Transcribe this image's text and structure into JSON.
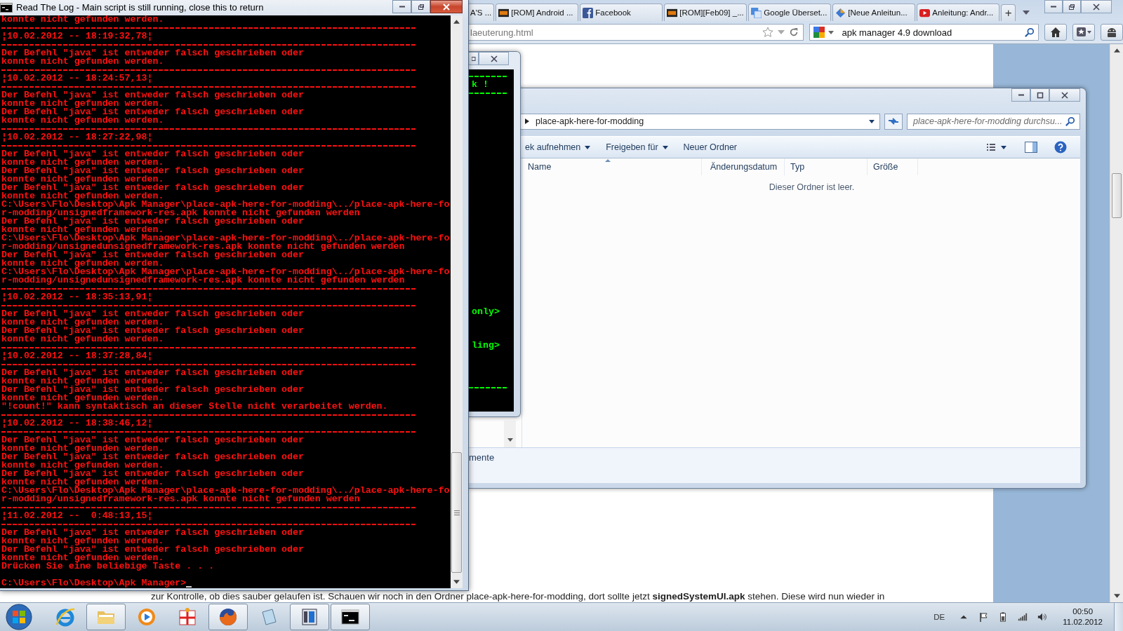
{
  "browser": {
    "tabs": [
      {
        "label": "A'S ...",
        "kind": "none"
      },
      {
        "label": "[ROM] Android ...",
        "kind": "xda"
      },
      {
        "label": "Facebook",
        "kind": "facebook"
      },
      {
        "label": "[ROM][Feb09] _...",
        "kind": "xda"
      },
      {
        "label": "Google Überset...",
        "kind": "translate"
      },
      {
        "label": "[Neue Anleitun...",
        "kind": "diamond"
      },
      {
        "label": "Anleitung: Andr...",
        "kind": "video"
      }
    ],
    "new_tab": "+",
    "url": "laeuterung.html",
    "search": "apk manager 4.9 download",
    "page_text": "zur Kontrolle, ob dies sauber gelaufen ist. Schauen wir noch in den Ordner place-apk-here-for-modding, dort sollte jetzt **signedSystemUI.apk** stehen. Diese wird nun wieder in"
  },
  "explorer": {
    "breadcrumb": "place-apk-here-for-modding",
    "search_placeholder": "place-apk-here-for-modding durchsu...",
    "toolbar": [
      {
        "label": "ek aufnehmen",
        "dropdown": true
      },
      {
        "label": "Freigeben für",
        "dropdown": true
      },
      {
        "label": "Neuer Ordner",
        "dropdown": false
      }
    ],
    "columns": [
      {
        "label": "Name",
        "sorted": true
      },
      {
        "label": "Änderungsdatum",
        "sorted": false
      },
      {
        "label": "Typ",
        "sorted": false
      },
      {
        "label": "Größe",
        "sorted": false
      }
    ],
    "empty_message": "Dieser Ordner ist leer.",
    "details_text": "mente"
  },
  "cmd_window": {
    "lines": [
      {
        "kind": "rule"
      },
      {
        "kind": "text",
        "text": "k !"
      },
      {
        "kind": "rule"
      },
      {
        "kind": "blank"
      },
      {
        "kind": "blank"
      },
      {
        "kind": "blank"
      },
      {
        "kind": "blank"
      },
      {
        "kind": "blank"
      },
      {
        "kind": "blank"
      },
      {
        "kind": "blank"
      },
      {
        "kind": "blank"
      },
      {
        "kind": "blank"
      },
      {
        "kind": "blank"
      },
      {
        "kind": "blank"
      },
      {
        "kind": "blank"
      },
      {
        "kind": "blank"
      },
      {
        "kind": "blank"
      },
      {
        "kind": "blank"
      },
      {
        "kind": "blank"
      },
      {
        "kind": "blank"
      },
      {
        "kind": "blank"
      },
      {
        "kind": "blank"
      },
      {
        "kind": "blank"
      },
      {
        "kind": "blank"
      },
      {
        "kind": "blank"
      },
      {
        "kind": "blank"
      },
      {
        "kind": "blank"
      },
      {
        "kind": "blank"
      },
      {
        "kind": "text",
        "text": "only>"
      },
      {
        "kind": "blank"
      },
      {
        "kind": "blank"
      },
      {
        "kind": "blank"
      },
      {
        "kind": "text",
        "text": "ling>"
      },
      {
        "kind": "blank"
      },
      {
        "kind": "blank"
      },
      {
        "kind": "blank"
      },
      {
        "kind": "blank"
      },
      {
        "kind": "rule"
      }
    ]
  },
  "console": {
    "title": "Read The Log - Main script is still running, close this to return",
    "lines": [
      {
        "kind": "text",
        "text": "konnte nicht gefunden werden."
      },
      {
        "kind": "rule"
      },
      {
        "kind": "text",
        "text": "¦10.02.2012 -- 18:19:32,78¦"
      },
      {
        "kind": "rule"
      },
      {
        "kind": "text",
        "text": "Der Befehl \"java\" ist entweder falsch geschrieben oder"
      },
      {
        "kind": "text",
        "text": "konnte nicht gefunden werden."
      },
      {
        "kind": "rule"
      },
      {
        "kind": "text",
        "text": "¦10.02.2012 -- 18:24:57,13¦"
      },
      {
        "kind": "rule"
      },
      {
        "kind": "text",
        "text": "Der Befehl \"java\" ist entweder falsch geschrieben oder"
      },
      {
        "kind": "text",
        "text": "konnte nicht gefunden werden."
      },
      {
        "kind": "text",
        "text": "Der Befehl \"java\" ist entweder falsch geschrieben oder"
      },
      {
        "kind": "text",
        "text": "konnte nicht gefunden werden."
      },
      {
        "kind": "rule"
      },
      {
        "kind": "text",
        "text": "¦10.02.2012 -- 18:27:22,98¦"
      },
      {
        "kind": "rule"
      },
      {
        "kind": "text",
        "text": "Der Befehl \"java\" ist entweder falsch geschrieben oder"
      },
      {
        "kind": "text",
        "text": "konnte nicht gefunden werden."
      },
      {
        "kind": "text",
        "text": "Der Befehl \"java\" ist entweder falsch geschrieben oder"
      },
      {
        "kind": "text",
        "text": "konnte nicht gefunden werden."
      },
      {
        "kind": "text",
        "text": "Der Befehl \"java\" ist entweder falsch geschrieben oder"
      },
      {
        "kind": "text",
        "text": "konnte nicht gefunden werden."
      },
      {
        "kind": "text",
        "text": "C:\\Users\\Flo\\Desktop\\Apk Manager\\place-apk-here-for-modding\\../place-apk-here-fo"
      },
      {
        "kind": "text",
        "text": "r-modding/unsignedframework-res.apk konnte nicht gefunden werden"
      },
      {
        "kind": "text",
        "text": "Der Befehl \"java\" ist entweder falsch geschrieben oder"
      },
      {
        "kind": "text",
        "text": "konnte nicht gefunden werden."
      },
      {
        "kind": "text",
        "text": "C:\\Users\\Flo\\Desktop\\Apk Manager\\place-apk-here-for-modding\\../place-apk-here-fo"
      },
      {
        "kind": "text",
        "text": "r-modding/unsignedunsignedframework-res.apk konnte nicht gefunden werden"
      },
      {
        "kind": "text",
        "text": "Der Befehl \"java\" ist entweder falsch geschrieben oder"
      },
      {
        "kind": "text",
        "text": "konnte nicht gefunden werden."
      },
      {
        "kind": "text",
        "text": "C:\\Users\\Flo\\Desktop\\Apk Manager\\place-apk-here-for-modding\\../place-apk-here-fo"
      },
      {
        "kind": "text",
        "text": "r-modding/unsignedunsignedframework-res.apk konnte nicht gefunden werden"
      },
      {
        "kind": "rule"
      },
      {
        "kind": "text",
        "text": "¦10.02.2012 -- 18:35:13,91¦"
      },
      {
        "kind": "rule"
      },
      {
        "kind": "text",
        "text": "Der Befehl \"java\" ist entweder falsch geschrieben oder"
      },
      {
        "kind": "text",
        "text": "konnte nicht gefunden werden."
      },
      {
        "kind": "text",
        "text": "Der Befehl \"java\" ist entweder falsch geschrieben oder"
      },
      {
        "kind": "text",
        "text": "konnte nicht gefunden werden."
      },
      {
        "kind": "rule"
      },
      {
        "kind": "text",
        "text": "¦10.02.2012 -- 18:37:28,84¦"
      },
      {
        "kind": "rule"
      },
      {
        "kind": "text",
        "text": "Der Befehl \"java\" ist entweder falsch geschrieben oder"
      },
      {
        "kind": "text",
        "text": "konnte nicht gefunden werden."
      },
      {
        "kind": "text",
        "text": "Der Befehl \"java\" ist entweder falsch geschrieben oder"
      },
      {
        "kind": "text",
        "text": "konnte nicht gefunden werden."
      },
      {
        "kind": "text",
        "text": "\"!count!\" kann syntaktisch an dieser Stelle nicht verarbeitet werden."
      },
      {
        "kind": "rule"
      },
      {
        "kind": "text",
        "text": "¦10.02.2012 -- 18:38:46,12¦"
      },
      {
        "kind": "rule"
      },
      {
        "kind": "text",
        "text": "Der Befehl \"java\" ist entweder falsch geschrieben oder"
      },
      {
        "kind": "text",
        "text": "konnte nicht gefunden werden."
      },
      {
        "kind": "text",
        "text": "Der Befehl \"java\" ist entweder falsch geschrieben oder"
      },
      {
        "kind": "text",
        "text": "konnte nicht gefunden werden."
      },
      {
        "kind": "text",
        "text": "Der Befehl \"java\" ist entweder falsch geschrieben oder"
      },
      {
        "kind": "text",
        "text": "konnte nicht gefunden werden."
      },
      {
        "kind": "text",
        "text": "C:\\Users\\Flo\\Desktop\\Apk Manager\\place-apk-here-for-modding\\../place-apk-here-fo"
      },
      {
        "kind": "text",
        "text": "r-modding/unsignedframework-res.apk konnte nicht gefunden werden"
      },
      {
        "kind": "rule"
      },
      {
        "kind": "text",
        "text": "¦11.02.2012 --  0:48:13,15¦"
      },
      {
        "kind": "rule"
      },
      {
        "kind": "text",
        "text": "Der Befehl \"java\" ist entweder falsch geschrieben oder"
      },
      {
        "kind": "text",
        "text": "konnte nicht gefunden werden."
      },
      {
        "kind": "text",
        "text": "Der Befehl \"java\" ist entweder falsch geschrieben oder"
      },
      {
        "kind": "text",
        "text": "konnte nicht gefunden werden."
      },
      {
        "kind": "text",
        "text": "Drücken Sie eine beliebige Taste . . ."
      },
      {
        "kind": "blank"
      },
      {
        "kind": "prompt",
        "text": "C:\\Users\\Flo\\Desktop\\Apk Manager>"
      }
    ]
  },
  "taskbar": {
    "apps": [
      {
        "kind": "ie",
        "open": false
      },
      {
        "kind": "folder",
        "open": true
      },
      {
        "kind": "media",
        "open": false
      },
      {
        "kind": "paint",
        "open": false
      },
      {
        "kind": "firefox",
        "open": true
      },
      {
        "kind": "notepad",
        "open": false
      },
      {
        "kind": "app",
        "open": true
      },
      {
        "kind": "console",
        "open": true
      }
    ],
    "language": "DE",
    "time": "00:50",
    "date": "11.02.2012"
  }
}
